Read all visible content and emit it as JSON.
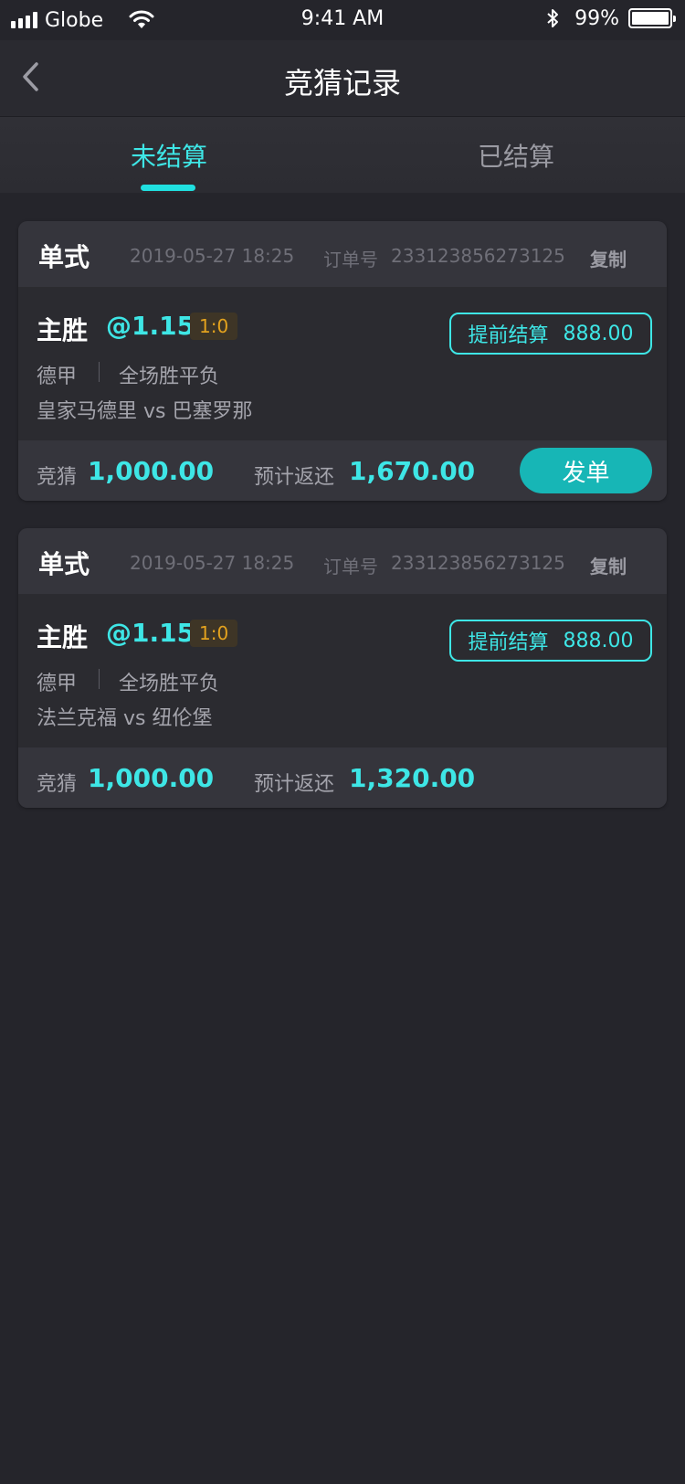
{
  "status_bar": {
    "carrier": "Globe",
    "time": "9:41 AM",
    "battery_percent": "99%",
    "battery_level": 0.99,
    "icons": [
      "signal-icon",
      "wifi-icon",
      "bluetooth-icon",
      "battery-icon"
    ]
  },
  "nav": {
    "title": "竞猜记录",
    "back_icon": "chevron-left-icon"
  },
  "tabs": [
    {
      "label": "未结算",
      "active": true
    },
    {
      "label": "已结算",
      "active": false
    }
  ],
  "colors": {
    "accent": "#3ee6e6",
    "button": "#17b6b6",
    "score_badge_text": "#e3a21e",
    "background": "#25252b"
  },
  "bets": [
    {
      "type": "单式",
      "datetime": "2019-05-27 18:25",
      "order_label": "订单号",
      "order_no": "233123856273125",
      "copy_label": "复制",
      "pick": "主胜",
      "odds": "@1.15",
      "score": "1:0",
      "league": "德甲",
      "market": "全场胜平负",
      "match": "皇家马德里 vs 巴塞罗那",
      "cashout_label": "提前结算",
      "cashout_value": "888.00",
      "stake_label": "竞猜",
      "stake": "1,000.00",
      "return_label": "预计返还",
      "return": "1,670.00",
      "send_label": "发单"
    },
    {
      "type": "单式",
      "datetime": "2019-05-27 18:25",
      "order_label": "订单号",
      "order_no": "233123856273125",
      "copy_label": "复制",
      "pick": "主胜",
      "odds": "@1.15",
      "score": "1:0",
      "league": "德甲",
      "market": "全场胜平负",
      "match": "法兰克福 vs 纽伦堡",
      "cashout_label": "提前结算",
      "cashout_value": "888.00",
      "stake_label": "竞猜",
      "stake": "1,000.00",
      "return_label": "预计返还",
      "return": "1,320.00"
    }
  ]
}
